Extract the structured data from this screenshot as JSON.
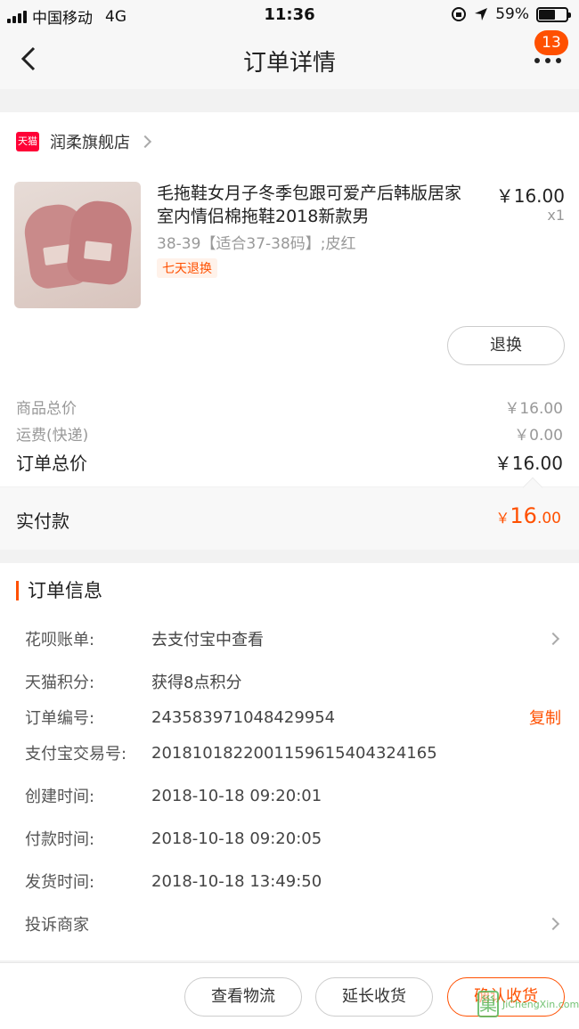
{
  "status_bar": {
    "carrier": "中国移动",
    "network": "4G",
    "time": "11:36",
    "battery_text": "59%",
    "battery_level": 0.59
  },
  "nav": {
    "title": "订单详情",
    "badge_count": "13"
  },
  "shop": {
    "icon_text": "天猫",
    "name": "润柔旗舰店"
  },
  "product": {
    "title": "毛拖鞋女月子冬季包跟可爱产后韩版居家室内情侣棉拖鞋2018新款男",
    "sku": "38-39【适合37-38码】;皮红",
    "tag": "七天退换",
    "price": "￥16.00",
    "qty": "x1",
    "refund_label": "退换"
  },
  "summary": {
    "goods_label": "商品总价",
    "goods_value": "￥16.00",
    "shipping_label": "运费(快递)",
    "shipping_value": "￥0.00",
    "total_label": "订单总价",
    "total_value": "￥16.00",
    "paid_label": "实付款",
    "paid_currency": "￥",
    "paid_integer": "16",
    "paid_decimal": ".00"
  },
  "order_info": {
    "title": "订单信息",
    "rows": [
      {
        "key": "花呗账单:",
        "value": "去支付宝中查看"
      },
      {
        "key": "天猫积分:",
        "value": "获得8点积分"
      },
      {
        "key": "订单编号:",
        "value": "243583971048429954",
        "action": "复制"
      },
      {
        "key": "支付宝交易号:",
        "value": "2018101822001159615404324165"
      },
      {
        "key": "创建时间:",
        "value": "2018-10-18 09:20:01"
      },
      {
        "key": "付款时间:",
        "value": "2018-10-18 09:20:05"
      },
      {
        "key": "发货时间:",
        "value": "2018-10-18 13:49:50"
      }
    ],
    "complaint_label": "投诉商家"
  },
  "actions": {
    "logistics": "查看物流",
    "extend": "延长收货",
    "confirm": "确认收货"
  },
  "watermark": {
    "glyph": "巢",
    "text": "JiChengXin.com"
  },
  "colors": {
    "accent": "#ff5000",
    "tmall": "#ff0036"
  }
}
